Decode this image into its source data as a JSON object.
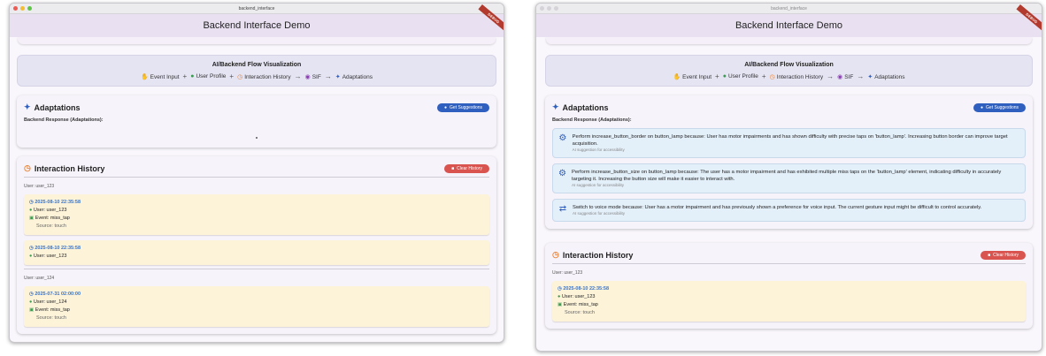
{
  "window_title": "backend_interface",
  "app_title": "Backend Interface Demo",
  "debug_banner": "DEBUG",
  "flow": {
    "title": "AI/Backend Flow Visualization",
    "steps": [
      "Event Input",
      "User Profile",
      "Interaction History",
      "SIF",
      "Adaptations"
    ]
  },
  "adaptations": {
    "title": "Adaptations",
    "button": "Get Suggestions",
    "subtitle": "Backend Response (Adaptations):",
    "suggestions": [
      {
        "icon": "gear-icon",
        "text": "Perform increase_button_border on button_lamp because: User has motor impairments and has shown difficulty with precise taps on 'button_lamp'. Increasing button border can improve target acquisition.",
        "hint": "AI suggestion for accessibility"
      },
      {
        "icon": "gear-icon",
        "text": "Perform increase_button_size on button_lamp because: The user has a motor impairment and has exhibited multiple miss taps on the 'button_lamp' element, indicating difficulty in accurately targeting it. Increasing the button size will make it easier to interact with.",
        "hint": "AI suggestion for accessibility"
      },
      {
        "icon": "swap-icon",
        "text": "Switch to voice mode because: User has a motor impairment and has previously shown a preference for voice input. The current gesture input might be difficult to control accurately.",
        "hint": "AI suggestion for accessibility"
      }
    ]
  },
  "history": {
    "title": "Interaction History",
    "button": "Clear History",
    "groups": [
      {
        "user": "User: user_123",
        "events": [
          {
            "ts": "2025-08-10 22:35:58",
            "user": "User: user_123",
            "event": "Event: miss_tap",
            "source": "Source: touch"
          },
          {
            "ts": "2025-08-10 22:35:58",
            "user": "User: user_123",
            "event": "",
            "source": ""
          }
        ]
      },
      {
        "user": "User: user_124",
        "events": [
          {
            "ts": "2025-07-31 02:00:00",
            "user": "User: user_124",
            "event": "Event: miss_tap",
            "source": "Source: touch"
          }
        ]
      }
    ]
  },
  "colors": {
    "accent": "#2f5fbf",
    "danger": "#d9534f",
    "appbar": "#e9e1f1"
  }
}
